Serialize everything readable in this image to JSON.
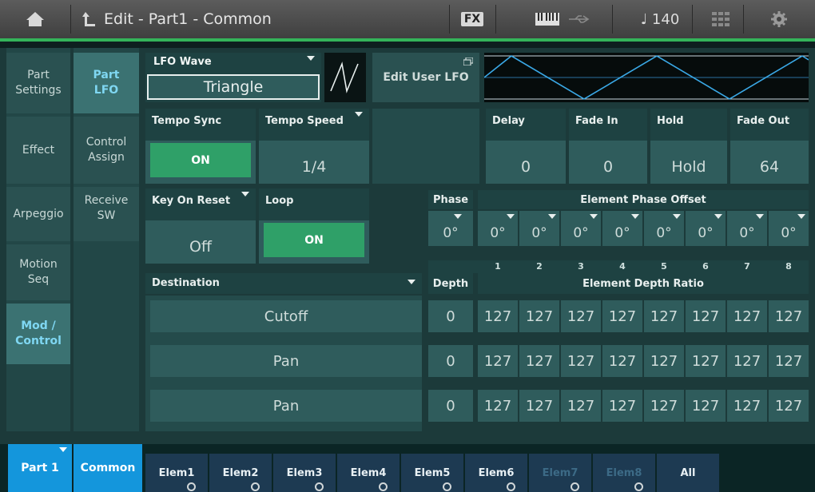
{
  "header": {
    "title": "Edit - Part1 - Common",
    "fx_label": "FX",
    "tempo": "♩ 140",
    "icons": [
      "home-icon",
      "back-icon",
      "keyboard-icon",
      "usb-icon",
      "grid-icon",
      "gear-icon"
    ]
  },
  "sidebar": {
    "main_tabs": [
      {
        "label": "Part\nSettings"
      },
      {
        "label": "Effect"
      },
      {
        "label": "Arpeggio"
      },
      {
        "label": "Motion\nSeq"
      },
      {
        "label": "Mod /\nControl",
        "active": true
      }
    ],
    "sub_tabs": [
      {
        "label": "Part\nLFO",
        "active": true
      },
      {
        "label": "Control\nAssign"
      },
      {
        "label": "Receive\nSW"
      }
    ]
  },
  "lfo": {
    "wave_label": "LFO Wave",
    "wave_value": "Triangle",
    "edit_user_lfo": "Edit User LFO",
    "tempo_sync": {
      "label": "Tempo Sync",
      "value": "ON"
    },
    "tempo_speed": {
      "label": "Tempo Speed",
      "value": "1/4"
    },
    "delay": {
      "label": "Delay",
      "value": "0"
    },
    "fade_in": {
      "label": "Fade In",
      "value": "0"
    },
    "hold": {
      "label": "Hold",
      "value": "Hold"
    },
    "fade_out": {
      "label": "Fade Out",
      "value": "64"
    },
    "key_on_reset": {
      "label": "Key On Reset",
      "value": "Off"
    },
    "loop": {
      "label": "Loop",
      "value": "ON"
    }
  },
  "phase": {
    "label": "Phase",
    "value": "0°",
    "offset_label": "Element Phase Offset",
    "offsets": [
      "0°",
      "0°",
      "0°",
      "0°",
      "0°",
      "0°",
      "0°",
      "0°"
    ],
    "element_numbers": [
      "1",
      "2",
      "3",
      "4",
      "5",
      "6",
      "7",
      "8"
    ]
  },
  "destinations": {
    "label": "Destination",
    "depth_label": "Depth",
    "ratio_label": "Element Depth Ratio",
    "rows": [
      {
        "destination": "Cutoff",
        "depth": "0",
        "ratios": [
          "127",
          "127",
          "127",
          "127",
          "127",
          "127",
          "127",
          "127"
        ]
      },
      {
        "destination": "Pan",
        "depth": "0",
        "ratios": [
          "127",
          "127",
          "127",
          "127",
          "127",
          "127",
          "127",
          "127"
        ]
      },
      {
        "destination": "Pan",
        "depth": "0",
        "ratios": [
          "127",
          "127",
          "127",
          "127",
          "127",
          "127",
          "127",
          "127"
        ]
      }
    ]
  },
  "bottom": {
    "part": "Part 1",
    "common": "Common",
    "elements": [
      {
        "label": "Elem1",
        "enabled": true
      },
      {
        "label": "Elem2",
        "enabled": true
      },
      {
        "label": "Elem3",
        "enabled": true
      },
      {
        "label": "Elem4",
        "enabled": true
      },
      {
        "label": "Elem5",
        "enabled": true
      },
      {
        "label": "Elem6",
        "enabled": true
      },
      {
        "label": "Elem7",
        "enabled": false
      },
      {
        "label": "Elem8",
        "enabled": false
      },
      {
        "label": "All",
        "enabled": true
      }
    ]
  }
}
